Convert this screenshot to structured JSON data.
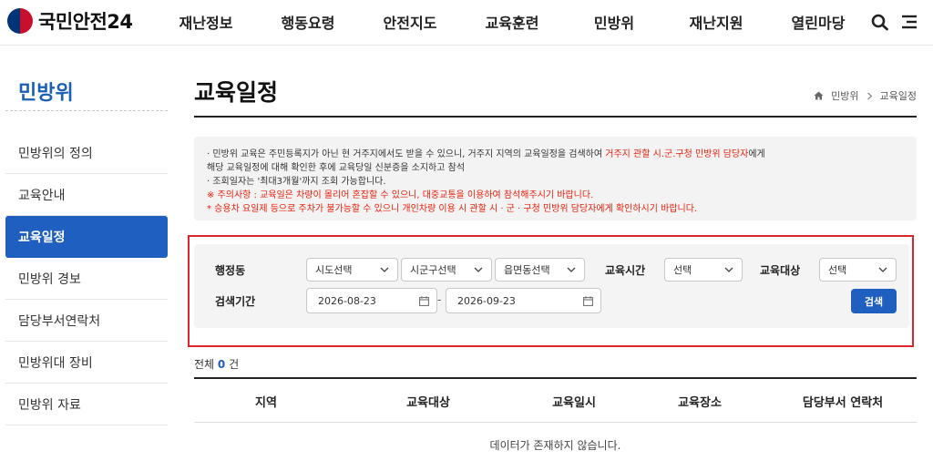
{
  "header": {
    "logo_text": "국민안전24",
    "menu": [
      "재난정보",
      "행동요령",
      "안전지도",
      "교육훈련",
      "민방위",
      "재난지원",
      "열린마당"
    ]
  },
  "sidebar": {
    "title": "민방위",
    "items": [
      {
        "label": "민방위의 정의",
        "active": false
      },
      {
        "label": "교육안내",
        "active": false
      },
      {
        "label": "교육일정",
        "active": true
      },
      {
        "label": "민방위 경보",
        "active": false
      },
      {
        "label": "담당부서연락처",
        "active": false
      },
      {
        "label": "민방위대 장비",
        "active": false
      },
      {
        "label": "민방위 자료",
        "active": false
      }
    ]
  },
  "page": {
    "title": "교육일정",
    "breadcrumb": [
      "민방위",
      "교육일정"
    ]
  },
  "notice": {
    "line1_a": "· 민방위 교육은 주민등록지가 아닌 현 거주지에서도 받을 수 있으니, 거주지 지역의 교육일정을 검색하여 ",
    "line1_red": "거주지 관할 시.군.구청 민방위 담당자",
    "line1_b": "에게",
    "line2": "해당 교육일정에 대해 확인한 후에 교육당일 신분증을 소지하고 참석",
    "line3": "· 조회일자는 '최대3개월'까지 조회 가능합니다.",
    "line4": "※ 주의사항 : 교육일은 차량이 몰리어 혼잡할 수 있으니, 대중교통을 이용하여 참석해주시기 바랍니다.",
    "line5": "* 승용차 요일제 등으로 주차가 불가능할 수 있으니 개인차량 이용 시 관할 시 · 군 · 구청 민방위 담당자에게 확인하시기 바랍니다."
  },
  "search": {
    "region_label": "행정동",
    "sido": "시도선택",
    "sigungu": "시군구선택",
    "eupmyeondong": "읍면동선택",
    "time_label": "교육시간",
    "time_value": "선택",
    "target_label": "교육대상",
    "target_value": "선택",
    "period_label": "검색기간",
    "date_from": "2026-08-23",
    "date_to": "2026-09-23",
    "date_sep": "-",
    "button": "검색"
  },
  "result": {
    "total_prefix": "전체",
    "total_count": "0",
    "total_suffix": "건",
    "columns": [
      "지역",
      "교육대상",
      "교육일시",
      "교육장소",
      "담당부서 연락처"
    ],
    "empty_message": "데이터가 존재하지 않습니다."
  },
  "colors": {
    "accent": "#1f5fbf",
    "highlight_frame": "#e0242b",
    "warning_text": "#e8200c"
  }
}
